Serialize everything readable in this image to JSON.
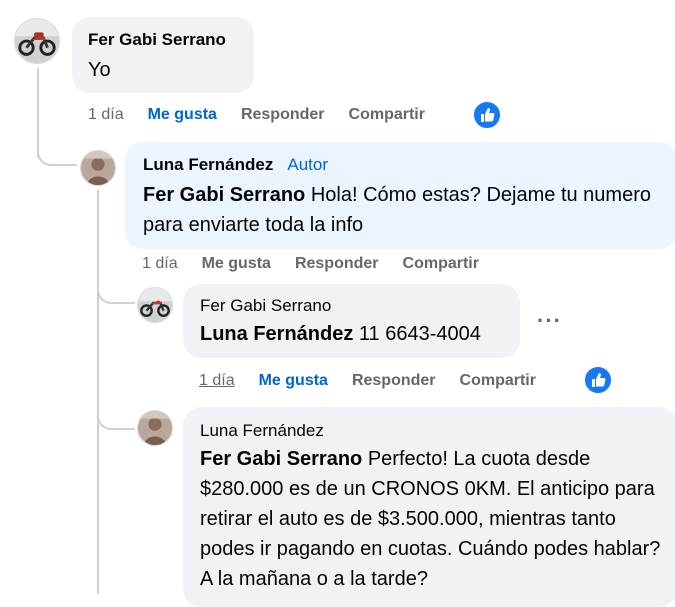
{
  "comments": [
    {
      "author": "Fer Gabi Serrano",
      "text": "Yo",
      "time": "1 día",
      "like": "Me gusta",
      "reply": "Responder",
      "share": "Compartir"
    },
    {
      "author": "Luna Fernández",
      "author_badge": "Autor",
      "mention": "Fer Gabi Serrano",
      "text": " Hola! Cómo estas? Dejame tu numero para enviarte toda la info",
      "time": "1 día",
      "like": "Me gusta",
      "reply": "Responder",
      "share": "Compartir"
    },
    {
      "author": "Fer Gabi Serrano",
      "mention": "Luna Fernández",
      "text": " 11 6643-4004",
      "time": "1 día",
      "like": "Me gusta",
      "reply": "Responder",
      "share": "Compartir",
      "more": "···"
    },
    {
      "author": "Luna Fernández",
      "mention": "Fer Gabi Serrano",
      "text": " Perfecto! La cuota desde $280.000 es de un CRONOS 0KM. El anticipo para retirar el auto es de $3.500.000, mientras tanto podes ir pagando en cuotas. Cuándo podes hablar? A la mañana o a la tarde?"
    }
  ],
  "colors": {
    "link_blue": "#0064d1",
    "reaction_blue": "#1877f2",
    "bubble_gray": "#f0f2f5",
    "bubble_author": "#ebf5ff",
    "meta_gray": "#65676b"
  },
  "icons": [
    "motorcycle-avatar",
    "person-avatar",
    "like-reaction-icon",
    "more-options-icon"
  ]
}
